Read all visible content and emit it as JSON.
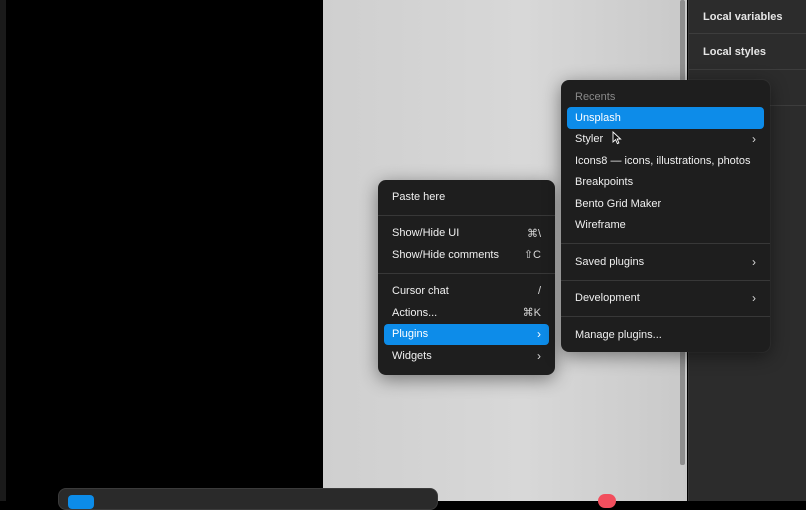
{
  "panel": {
    "items": [
      {
        "label": "Local variables"
      },
      {
        "label": "Local styles"
      }
    ]
  },
  "context_menu": {
    "paste_here": "Paste here",
    "show_hide_ui": {
      "label": "Show/Hide UI",
      "shortcut": "⌘\\"
    },
    "show_hide_comments": {
      "label": "Show/Hide comments",
      "shortcut": "⇧C"
    },
    "cursor_chat": {
      "label": "Cursor chat",
      "shortcut": "/"
    },
    "actions": {
      "label": "Actions...",
      "shortcut": "⌘K"
    },
    "plugins": {
      "label": "Plugins",
      "chevron": "›"
    },
    "widgets": {
      "label": "Widgets",
      "chevron": "›"
    }
  },
  "plugins_menu": {
    "recents_heading": "Recents",
    "recents": [
      {
        "label": "Unsplash",
        "active": true
      },
      {
        "label": "Styler",
        "chevron": "›"
      },
      {
        "label": "Icons8 — icons, illustrations, photos"
      },
      {
        "label": "Breakpoints"
      },
      {
        "label": "Bento Grid Maker"
      },
      {
        "label": "Wireframe"
      }
    ],
    "saved_plugins": {
      "label": "Saved plugins",
      "chevron": "›"
    },
    "development": {
      "label": "Development",
      "chevron": "›"
    },
    "manage_plugins": "Manage plugins..."
  },
  "colors": {
    "accent": "#0d8ce9",
    "menu_bg": "#1e1e1e",
    "panel_bg": "#2c2c2c",
    "canvas_bg": "#d4d4d4"
  },
  "icons": {
    "cursor": "arrow-cursor-icon"
  }
}
